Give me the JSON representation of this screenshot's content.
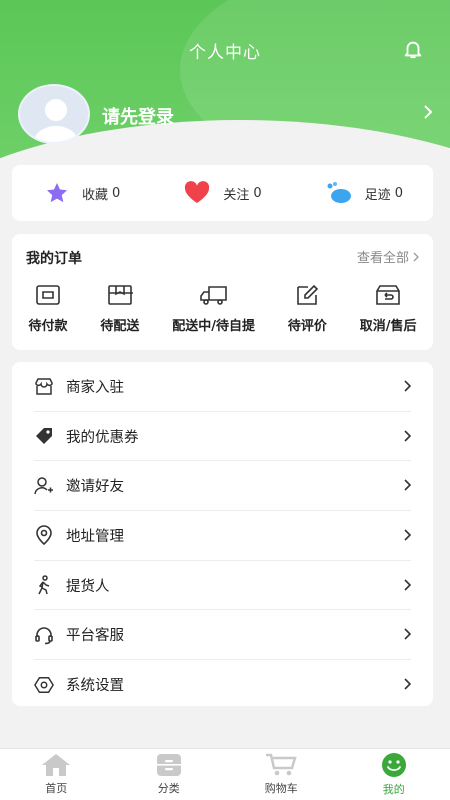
{
  "header": {
    "title": "个人中心",
    "login_prompt": "请先登录"
  },
  "stats": [
    {
      "label": "收藏",
      "count": "0",
      "icon": "star-icon"
    },
    {
      "label": "关注",
      "count": "0",
      "icon": "heart-icon"
    },
    {
      "label": "足迹",
      "count": "0",
      "icon": "footprint-icon"
    }
  ],
  "orders": {
    "title": "我的订单",
    "view_all": "查看全部",
    "items": [
      {
        "label": "待付款",
        "icon": "wallet-icon"
      },
      {
        "label": "待配送",
        "icon": "box-icon"
      },
      {
        "label": "配送中/待自提",
        "icon": "truck-icon"
      },
      {
        "label": "待评价",
        "icon": "edit-icon"
      },
      {
        "label": "取消/售后",
        "icon": "return-icon"
      }
    ]
  },
  "menu": [
    {
      "label": "商家入驻",
      "icon": "store-icon"
    },
    {
      "label": "我的优惠券",
      "icon": "coupon-icon"
    },
    {
      "label": "邀请好友",
      "icon": "add-user-icon"
    },
    {
      "label": "地址管理",
      "icon": "location-icon"
    },
    {
      "label": "提货人",
      "icon": "person-walk-icon"
    },
    {
      "label": "平台客服",
      "icon": "headset-icon"
    },
    {
      "label": "系统设置",
      "icon": "settings-icon"
    }
  ],
  "tabbar": [
    {
      "label": "首页",
      "icon": "home-icon"
    },
    {
      "label": "分类",
      "icon": "category-icon"
    },
    {
      "label": "购物车",
      "icon": "cart-icon"
    },
    {
      "label": "我的",
      "icon": "smile-icon",
      "active": true
    }
  ],
  "colors": {
    "primary": "#5cc757",
    "active_tab": "#3aa83a",
    "star": "#8c6cf0",
    "heart": "#f0424a",
    "footprint": "#3ba5f0"
  }
}
